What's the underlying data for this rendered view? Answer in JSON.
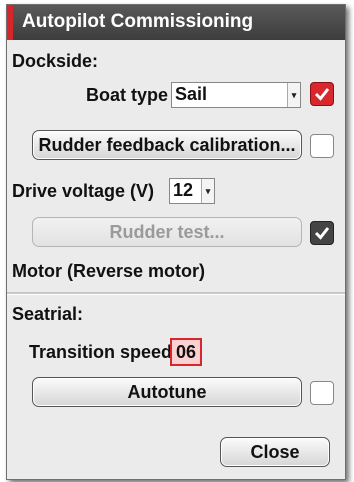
{
  "dialog": {
    "title": "Autopilot Commissioning"
  },
  "dockside": {
    "heading": "Dockside:",
    "boat_type_label": "Boat type",
    "boat_type_value": "Sail",
    "rudder_feedback_button": "Rudder feedback calibration...",
    "drive_voltage_label": "Drive voltage (V)",
    "drive_voltage_value": "12",
    "rudder_test_button": "Rudder test...",
    "motor_text": "Motor (Reverse motor)"
  },
  "seatrial": {
    "heading": "Seatrial:",
    "transition_speed_label": "Transition speed",
    "transition_speed_value": "06",
    "autotune_button": "Autotune"
  },
  "footer": {
    "close_button": "Close"
  },
  "checkboxes": {
    "boat_type_checked": true,
    "rudder_feedback_checked": false,
    "rudder_test_checked": true,
    "autotune_checked": false
  },
  "colors": {
    "accent": "#d8252c",
    "titlebar": "#4a4a4a",
    "panel": "#ebebeb"
  },
  "icons": {
    "check": "checkmark-icon",
    "dropdown": "chevron-down-icon"
  }
}
